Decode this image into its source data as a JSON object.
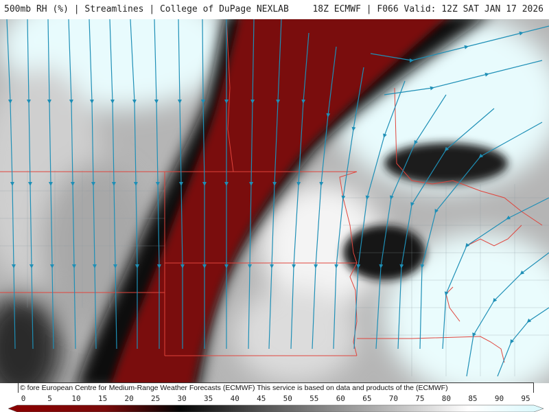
{
  "header": {
    "left": "500mb RH (%) | Streamlines | College of DuPage NEXLAB",
    "right": "18Z ECMWF | F066 Valid: 12Z SAT JAN 17 2026"
  },
  "credit": "© fore European Centre for Medium-Range Weather Forecasts (ECMWF)  This service is based on data and products of the (ECMWF)",
  "colorbar": {
    "ticks": [
      "0",
      "5",
      "10",
      "15",
      "20",
      "25",
      "30",
      "35",
      "40",
      "45",
      "50",
      "55",
      "60",
      "65",
      "70",
      "75",
      "80",
      "85",
      "90",
      "95"
    ],
    "colors": [
      "#8b0000",
      "#000000",
      "#ffffff",
      "#d8f8fc"
    ]
  },
  "map": {
    "colors": {
      "dry": "#7a0a0a",
      "transition": "#111111",
      "moist": "#ffffff",
      "saturated": "#d9f7fb",
      "streamline": "#1e8fb6",
      "borders": "#e0443c"
    }
  }
}
